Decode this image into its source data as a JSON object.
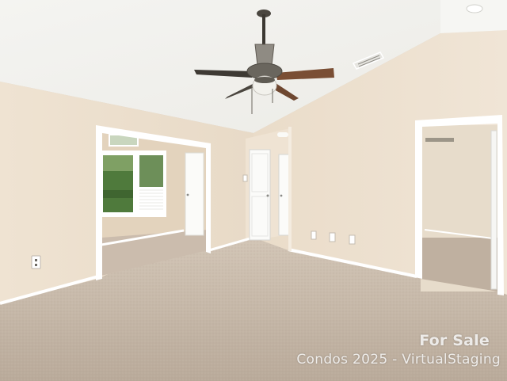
{
  "watermark": {
    "line1": "For Sale",
    "line2": "Condos 2025 - VirtualStaging"
  },
  "scene": {
    "subject": "empty bedroom with carpet and ceiling fan",
    "colors": {
      "wall": "#ece0cf",
      "ceiling": "#f2f1ec",
      "carpet": "#c6b8a9",
      "trim": "#ffffff",
      "fan_blade": "#7a4e34"
    },
    "icons": [
      "ceiling-fan-icon",
      "window-icon",
      "door-icon",
      "outlet-icon",
      "vent-icon"
    ]
  }
}
